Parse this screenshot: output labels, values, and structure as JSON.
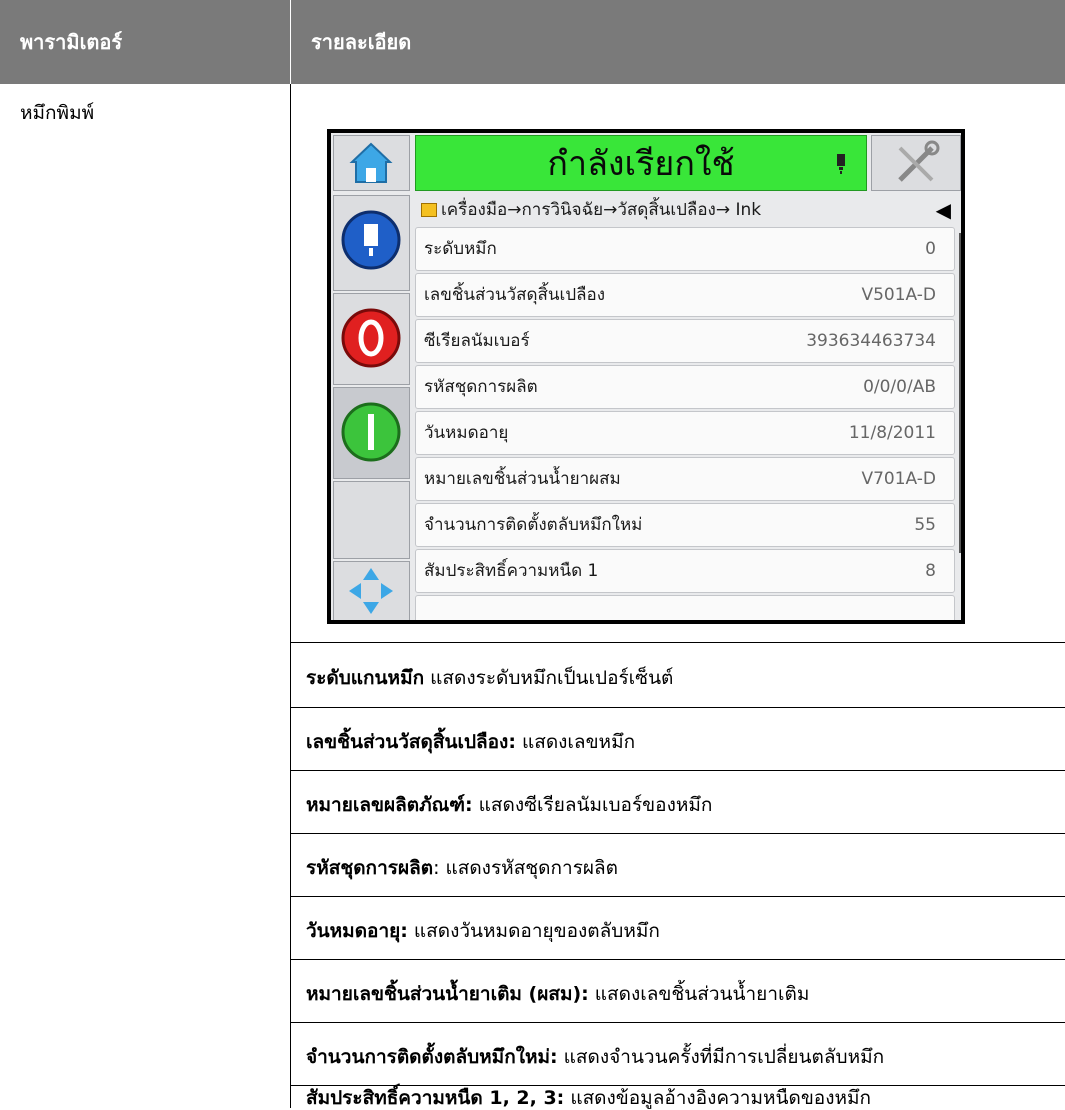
{
  "table": {
    "header_param": "พารามิเตอร์",
    "header_detail": "รายละเอียด",
    "param_name": "หมึกพิมพ์"
  },
  "device_screen": {
    "status_text": "กำลังเรียกใช้",
    "breadcrumb": "เครื่องมือ→การวินิจฉัย→วัสดุสิ้นเปลือง→ Ink",
    "rows": [
      {
        "label": "ระดับหมึก",
        "value": "0"
      },
      {
        "label": "เลขชิ้นส่วนวัสดุสิ้นเปลือง",
        "value": "V501A-D"
      },
      {
        "label": "ซีเรียลนัมเบอร์",
        "value": "393634463734"
      },
      {
        "label": "รหัสชุดการผลิต",
        "value": "0/0/0/AB"
      },
      {
        "label": "วันหมดอายุ",
        "value": "11/8/2011"
      },
      {
        "label": "หมายเลขชิ้นส่วนน้ำยาผสม",
        "value": "V701A-D"
      },
      {
        "label": "จำนวนการติดตั้งตลับหมึกใหม่",
        "value": "55"
      },
      {
        "label": "สัมประสิทธิ์ความหนืด 1",
        "value": "8"
      }
    ],
    "icons": {
      "home": "home-icon",
      "tools": "tools-icon",
      "ink": "ink-cartridge-icon",
      "stop": "stop-icon",
      "start": "start-icon",
      "nav": "navigation-arrows-icon"
    },
    "colors": {
      "status_green": "#39e639",
      "stop_red": "#e02020",
      "start_green": "#3cc43c",
      "ink_blue": "#1f5fc8"
    }
  },
  "descriptions": [
    {
      "term": "ระดับแกนหมึก",
      "text": " แสดงระดับหมึกเป็นเปอร์เซ็นต์"
    },
    {
      "term": "เลขชิ้นส่วนวัสดุสิ้นเปลือง:",
      "text": " แสดงเลขหมึก"
    },
    {
      "term": "หมายเลขผลิตภัณฑ์:",
      "text": " แสดงซีเรียลนัมเบอร์ของหมึก"
    },
    {
      "term": "รหัสชุดการผลิต",
      "text": ": แสดงรหัสชุดการผลิต"
    },
    {
      "term": "วันหมดอายุ:",
      "text": " แสดงวันหมดอายุของตลับหมึก"
    },
    {
      "term": "หมายเลขชิ้นส่วนน้ำยาเติม (ผสม):",
      "text": " แสดงเลขชิ้นส่วนน้ำยาเติม"
    },
    {
      "term": "จำนวนการติดตั้งตลับหมึกใหม่:",
      "text": " แสดงจำนวนครั้งที่มีการเปลี่ยนตลับหมึก"
    },
    {
      "term": "สัมประสิทธิ์ความหนืด 1, 2, 3:",
      "text": " แสดงข้อมูลอ้างอิงความหนืดของหมึก"
    }
  ]
}
